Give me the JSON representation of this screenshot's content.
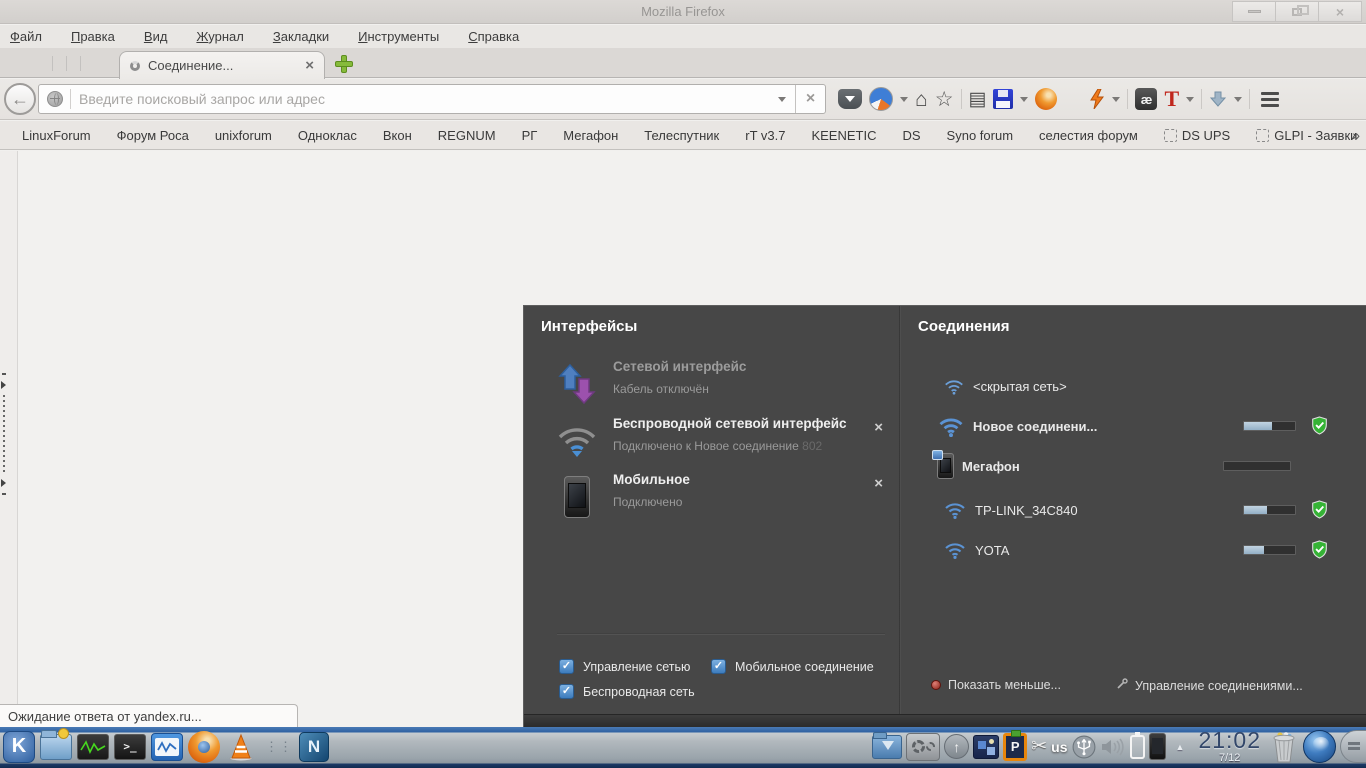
{
  "window": {
    "title": "Mozilla Firefox"
  },
  "menubar": {
    "items": [
      {
        "key": "Ф",
        "rest": "айл"
      },
      {
        "key": "П",
        "rest": "равка"
      },
      {
        "key": "В",
        "rest": "ид"
      },
      {
        "key": "Ж",
        "rest": "урнал"
      },
      {
        "key": "З",
        "rest": "акладки"
      },
      {
        "key": "И",
        "rest": "нструменты"
      },
      {
        "key": "С",
        "rest": "правка"
      }
    ]
  },
  "tabbar": {
    "active_tab": "Соединение...",
    "close_glyph": "×"
  },
  "navbar": {
    "back_glyph": "←",
    "url_placeholder": "Введите поисковый запрос или адрес",
    "stop_glyph": "×"
  },
  "glyphs": {
    "home": "⌂",
    "star": "☆",
    "clipboard": "▤",
    "translate": "æ",
    "text_tool": "T",
    "scissors": "✂",
    "up_arrow": "↑",
    "triangle_up": "▲",
    "separator_dots": "⋮⋮",
    "check": "✓",
    "terminal": ">_"
  },
  "bookmarks": {
    "overflow": "»",
    "items": [
      {
        "label": "LinuxForum"
      },
      {
        "label": "Форум Роса"
      },
      {
        "label": "unixforum"
      },
      {
        "label": "Одноклас"
      },
      {
        "label": "Вкон"
      },
      {
        "label": "REGNUM"
      },
      {
        "label": "РГ"
      },
      {
        "label": "Мегафон"
      },
      {
        "label": "Телеспутник"
      },
      {
        "label": "rT v3.7"
      },
      {
        "label": "KEENETIC"
      },
      {
        "label": "DS"
      },
      {
        "label": "Syno forum"
      },
      {
        "label": "селестия форум"
      },
      {
        "label": "DS UPS"
      },
      {
        "label": "GLPI - Заявки"
      }
    ]
  },
  "content": {
    "status": "Ожидание ответа от yandex.ru..."
  },
  "popup": {
    "interfaces": {
      "title": "Интерфейсы",
      "items": [
        {
          "title": "Сетевой интерфейс",
          "subtitle": "Кабель отключён"
        },
        {
          "title": "Беспроводной сетевой интерфейс",
          "subtitle": "Подключено к Новое соединение ",
          "subtitle_faded": "802"
        },
        {
          "title": "Мобильное",
          "subtitle": "Подключено"
        }
      ],
      "close_glyph": "×",
      "checkboxes": [
        {
          "label": "Управление сетью",
          "checked": true
        },
        {
          "label": "Мобильное соединение",
          "checked": true
        },
        {
          "label": "Беспроводная сеть",
          "checked": true
        }
      ]
    },
    "connections": {
      "title": "Соединения",
      "items": [
        {
          "name": "<скрытая сеть>",
          "type": "wifi"
        },
        {
          "name": "Новое соединени...",
          "type": "wifi",
          "signal": 55,
          "secure": true
        },
        {
          "name": "Мегафон",
          "type": "mobile",
          "signal": 0
        },
        {
          "name": "TP-LINK_34C840",
          "type": "wifi",
          "signal": 45,
          "secure": true
        },
        {
          "name": "YOTA",
          "type": "wifi",
          "signal": 40,
          "secure": true
        }
      ],
      "show_less": "Показать меньше...",
      "manage": "Управление соединениями..."
    }
  },
  "taskbar": {
    "kde_letter": "K",
    "netbeans_letter": "N",
    "pclip_letter": "P",
    "keyboard_layout": "us",
    "clock_time": "21:02",
    "clock_date": "7/12"
  }
}
